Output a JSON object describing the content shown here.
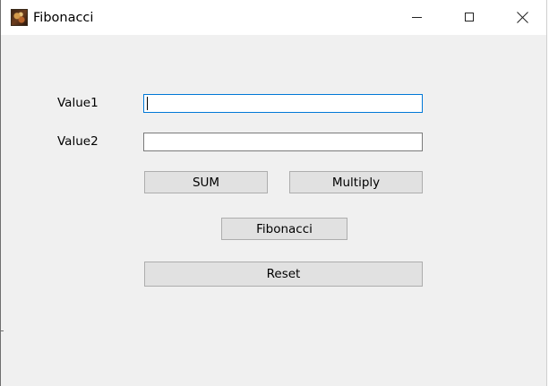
{
  "window": {
    "title": "Fibonacci",
    "icon": "fibonacci-app-icon",
    "controls": {
      "minimize_icon": "minimize-icon",
      "maximize_icon": "maximize-icon",
      "close_icon": "close-icon"
    }
  },
  "form": {
    "value1": {
      "label": "Value1",
      "value": "",
      "focused": true
    },
    "value2": {
      "label": "Value2",
      "value": ""
    },
    "buttons": {
      "sum": "SUM",
      "multiply": "Multiply",
      "fibonacci": "Fibonacci",
      "reset": "Reset"
    }
  },
  "colors": {
    "title_bar": "#ffffff",
    "client_area": "#f0f0f0",
    "button_face": "#e1e1e1",
    "button_border": "#adadad",
    "focus_border": "#0078d7"
  }
}
